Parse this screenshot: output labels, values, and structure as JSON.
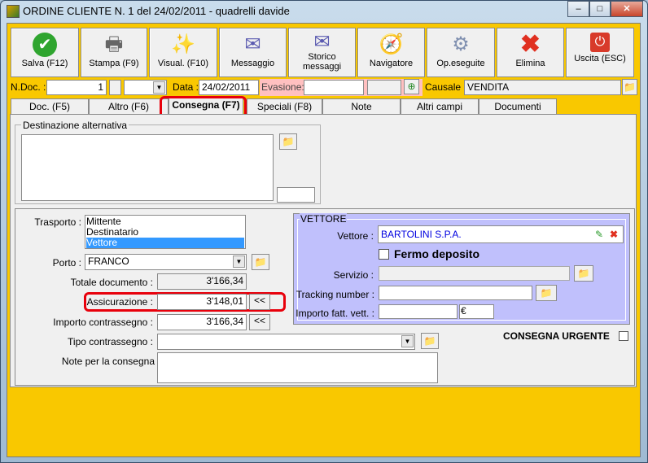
{
  "window": {
    "title": "ORDINE CLIENTE N. 1  del 24/02/2011 - quadrelli davide",
    "minimize": "–",
    "maximize": "□",
    "close": "✕"
  },
  "toolbar": [
    {
      "label": "Salva (F12)",
      "icon": "checkmark-icon"
    },
    {
      "label": "Stampa (F9)",
      "icon": "printer-icon"
    },
    {
      "label": "Visual. (F10)",
      "icon": "magic-wand-icon"
    },
    {
      "label": "Messaggio",
      "icon": "envelope-pen-icon"
    },
    {
      "label": "Storico messaggi",
      "icon": "envelope-search-icon"
    },
    {
      "label": "Navigatore",
      "icon": "compass-icon"
    },
    {
      "label": "Op.eseguite",
      "icon": "gears-search-icon"
    },
    {
      "label": "Elimina",
      "icon": "red-x-icon"
    },
    {
      "label": "Uscita (ESC)",
      "icon": "power-icon"
    }
  ],
  "header": {
    "ndoc_label": "N.Doc. :",
    "ndoc_value": "1",
    "data_label": "Data :",
    "data_value": "24/02/2011",
    "evasione_label": "Evasione:",
    "evasione_value": "",
    "causale_label": "Causale :",
    "causale_value": "VENDITA"
  },
  "tabs": [
    "Doc. (F5)",
    "Altro (F6)",
    "Consegna (F7)",
    "Speciali (F8)",
    "Note",
    "Altri campi",
    "Documenti"
  ],
  "active_tab": "Consegna (F7)",
  "destinazione": {
    "legend": "Destinazione alternativa",
    "value": ""
  },
  "trasporto": {
    "label": "Trasporto :",
    "options": [
      "Mittente",
      "Destinatario",
      "Vettore"
    ],
    "selected": "Vettore"
  },
  "porto": {
    "label": "Porto :",
    "value": "FRANCO"
  },
  "totale": {
    "label": "Totale documento :",
    "value": "3'166,34"
  },
  "assicurazione": {
    "label": "Assicurazione :",
    "value": "3'148,01",
    "button": "<<"
  },
  "contrassegno": {
    "label": "Importo contrassegno :",
    "value": "3'166,34",
    "button": "<<"
  },
  "tipo_contrassegno": {
    "label": "Tipo contrassegno :",
    "value": ""
  },
  "note_consegna": {
    "label": "Note per la consegna",
    "value": ""
  },
  "vettore": {
    "legend": "VETTORE",
    "vettore_label": "Vettore :",
    "vettore_value": "BARTOLINI S.P.A.",
    "fermo_label": "Fermo deposito",
    "servizio_label": "Servizio :",
    "tracking_label": "Tracking number :",
    "importo_label": "Importo fatt. vett. :",
    "currency": "€"
  },
  "urgente": {
    "label": "CONSEGNA URGENTE"
  },
  "colors": {
    "accent": "#f9c800",
    "vettore_bg": "#c0c0fc",
    "highlight": "#e8000b",
    "selection": "#3399ff"
  }
}
